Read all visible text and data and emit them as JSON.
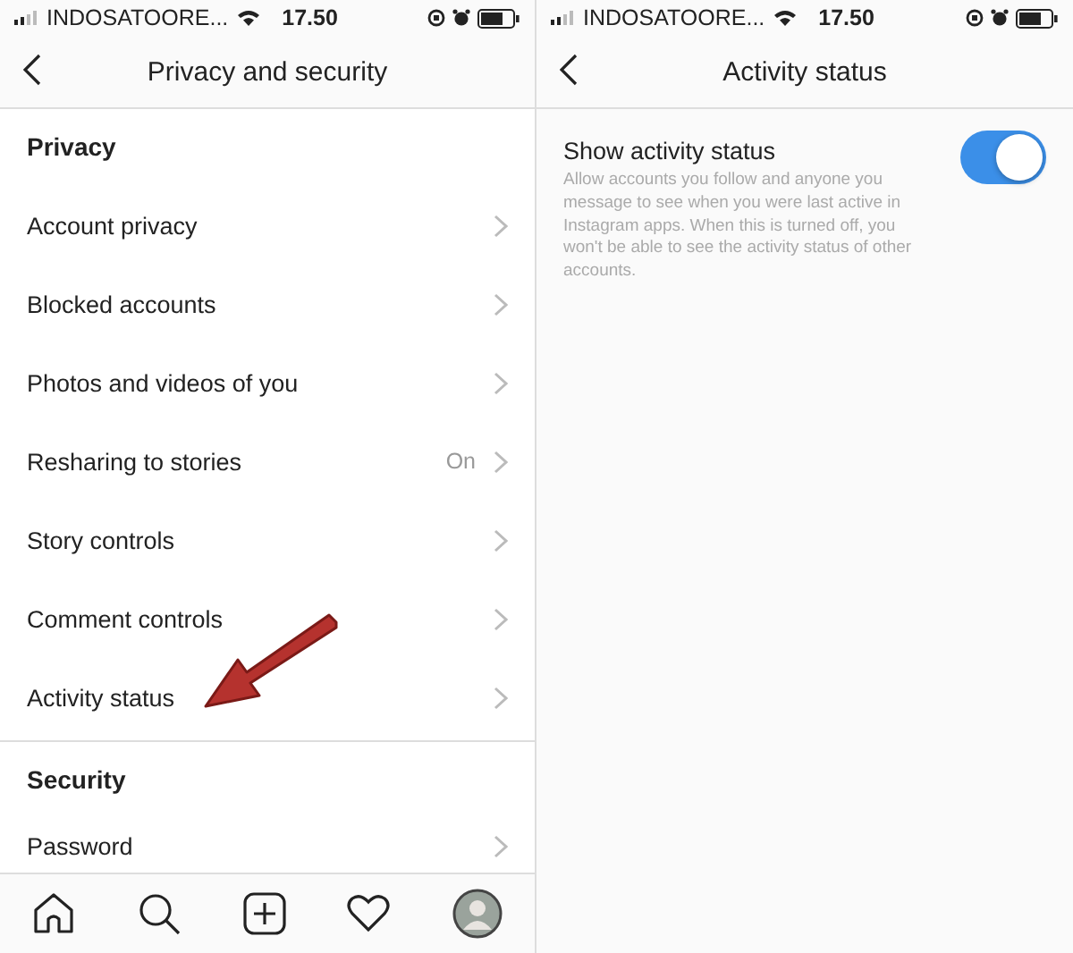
{
  "left_screen": {
    "status_bar": {
      "carrier": "INDOSATOORE...",
      "time": "17.50"
    },
    "title": "Privacy and security",
    "sections": [
      {
        "heading": "Privacy",
        "items": [
          {
            "label": "Account privacy"
          },
          {
            "label": "Blocked accounts"
          },
          {
            "label": "Photos and videos of you"
          },
          {
            "label": "Resharing to stories",
            "value": "On"
          },
          {
            "label": "Story controls"
          },
          {
            "label": "Comment controls"
          },
          {
            "label": "Activity status"
          }
        ]
      },
      {
        "heading": "Security",
        "items": [
          {
            "label": "Password"
          }
        ]
      }
    ],
    "tab_bar": [
      {
        "kind": "home"
      },
      {
        "kind": "search"
      },
      {
        "kind": "add"
      },
      {
        "kind": "heart"
      },
      {
        "kind": "profile"
      }
    ]
  },
  "right_screen": {
    "status_bar": {
      "carrier": "INDOSATOORE...",
      "time": "17.50"
    },
    "title": "Activity status",
    "setting": {
      "label": "Show activity status",
      "on": true,
      "description": "Allow accounts you follow and anyone you message to see when you were last active in Instagram apps. When this is turned off, you won't be able to see the activity status of other accounts."
    }
  }
}
